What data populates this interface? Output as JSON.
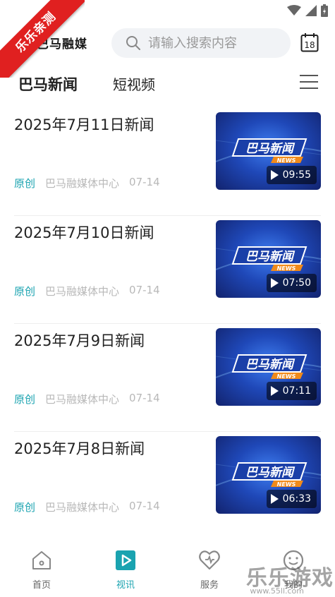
{
  "ribbon": {
    "text": "乐乐亲测"
  },
  "header": {
    "brand_name": "巴马融媒",
    "search_placeholder": "请输入搜索内容",
    "calendar_day": "18"
  },
  "tabs": [
    {
      "label": "巴马新闻",
      "active": true
    },
    {
      "label": "短视频",
      "active": false
    }
  ],
  "news": [
    {
      "title": "2025年7月11日新闻",
      "tag": "原创",
      "source": "巴马融媒体中心",
      "date": "07-14",
      "duration": "09:55",
      "thumb_title": "巴马新闻",
      "thumb_badge": "NEWS"
    },
    {
      "title": "2025年7月10日新闻",
      "tag": "原创",
      "source": "巴马融媒体中心",
      "date": "07-14",
      "duration": "07:50",
      "thumb_title": "巴马新闻",
      "thumb_badge": "NEWS"
    },
    {
      "title": "2025年7月9日新闻",
      "tag": "原创",
      "source": "巴马融媒体中心",
      "date": "07-14",
      "duration": "07:11",
      "thumb_title": "巴马新闻",
      "thumb_badge": "NEWS"
    },
    {
      "title": "2025年7月8日新闻",
      "tag": "原创",
      "source": "巴马融媒体中心",
      "date": "07-14",
      "duration": "06:33",
      "thumb_title": "巴马新闻",
      "thumb_badge": "NEWS"
    }
  ],
  "bottom_nav": [
    {
      "label": "首页",
      "icon": "home-icon",
      "active": false
    },
    {
      "label": "视讯",
      "icon": "video-icon",
      "active": true
    },
    {
      "label": "服务",
      "icon": "heart-icon",
      "active": false
    },
    {
      "label": "我的",
      "icon": "smile-icon",
      "active": false
    }
  ],
  "watermark": {
    "text": "乐乐游戏",
    "sub": "www.55ll.com"
  },
  "colors": {
    "accent": "#1aa3b0",
    "ribbon": "#e02020",
    "thumb_blue": "#1f48b8"
  }
}
